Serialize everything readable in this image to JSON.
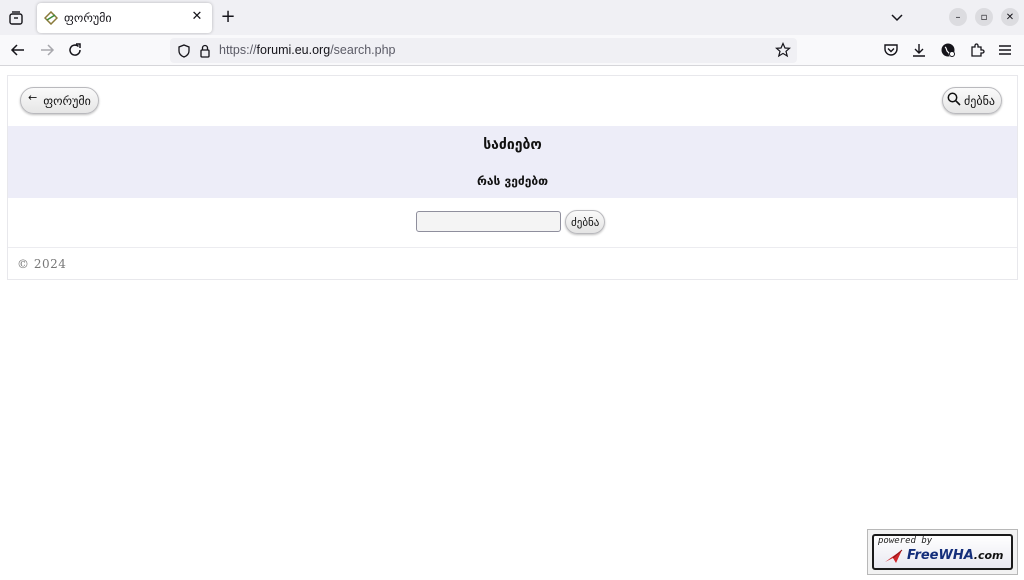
{
  "browser": {
    "tab_title": "ფორუმი",
    "tab_close_glyph": "✕",
    "new_tab_glyph": "+",
    "minimize_glyph": "–",
    "restore_glyph": "▫",
    "close_glyph": "✕",
    "url_scheme": "https://",
    "url_host": "forumi.eu.org",
    "url_path": "/search.php"
  },
  "page": {
    "back_arrow": "←",
    "back_label": "ფორუმი",
    "search_button_label": "ძებნა",
    "title": "საძიებო",
    "search_label": "რას ვეძებთ",
    "search_input_value": "",
    "submit_label": "ძებნა",
    "footer": "© 2024"
  },
  "badge": {
    "powered_by": "powered by",
    "brand": "FreeWHA",
    "domain": ".com"
  },
  "colors": {
    "title_band": "#ededf8",
    "badge_brand": "#142e7a"
  }
}
